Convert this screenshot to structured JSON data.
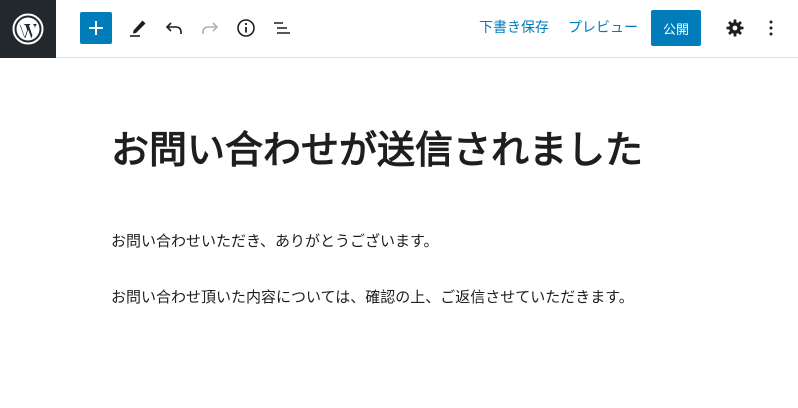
{
  "toolbar": {
    "logo": "wordpress-icon",
    "add_block_icon": "plus-icon",
    "tools_icon": "pencil-icon",
    "undo_icon": "undo-icon",
    "redo_icon": "redo-icon",
    "details_icon": "info-icon",
    "outline_icon": "list-view-icon",
    "save_draft_label": "下書き保存",
    "preview_label": "プレビュー",
    "publish_label": "公開",
    "settings_icon": "gear-icon",
    "options_icon": "more-vertical-icon",
    "accent_color": "#007cba",
    "logo_bg_color": "#23282d"
  },
  "post": {
    "title": "お問い合わせが送信されました",
    "paragraphs": [
      "お問い合わせいただき、ありがとうございます。",
      "お問い合わせ頂いた内容については、確認の上、ご返信させていただきます。"
    ]
  }
}
